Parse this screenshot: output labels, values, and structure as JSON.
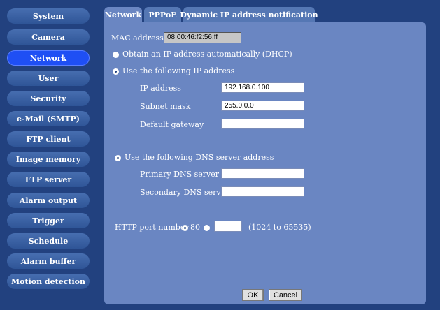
{
  "sidebar": {
    "items": [
      {
        "label": "System"
      },
      {
        "label": "Camera"
      },
      {
        "label": "Network"
      },
      {
        "label": "User"
      },
      {
        "label": "Security"
      },
      {
        "label": "e-Mail (SMTP)"
      },
      {
        "label": "FTP client"
      },
      {
        "label": "Image memory"
      },
      {
        "label": "FTP server"
      },
      {
        "label": "Alarm output"
      },
      {
        "label": "Trigger"
      },
      {
        "label": "Schedule"
      },
      {
        "label": "Alarm buffer"
      },
      {
        "label": "Motion detection"
      }
    ],
    "active_item": "Network"
  },
  "tabs": [
    {
      "label": "Network"
    },
    {
      "label": "PPPoE"
    },
    {
      "label": "Dynamic IP address notification"
    }
  ],
  "active_tab": "Network",
  "network": {
    "mac_label": "MAC address",
    "mac_value": "08:00:46:f2:56:ff",
    "dhcp_label": "Obtain an IP address automatically (DHCP)",
    "static_label": "Use the following IP address",
    "ip_label": "IP address",
    "ip_value": "192.168.0.100",
    "subnet_label": "Subnet mask",
    "subnet_value": "255.0.0.0",
    "gateway_label": "Default gateway",
    "gateway_value": "",
    "dns_label": "Use the following DNS server address",
    "primary_dns_label": "Primary DNS server",
    "primary_dns_value": "",
    "secondary_dns_label": "Secondary DNS server",
    "secondary_dns_value": "",
    "http_label": "HTTP port number",
    "http_default": "80",
    "http_custom_value": "",
    "http_range": "(1024 to 65535)",
    "ok_label": "OK",
    "cancel_label": "Cancel"
  },
  "colors": {
    "background": "#22417f",
    "panel": "#6a86c2",
    "active_sidebar": "#1f4ff4"
  }
}
